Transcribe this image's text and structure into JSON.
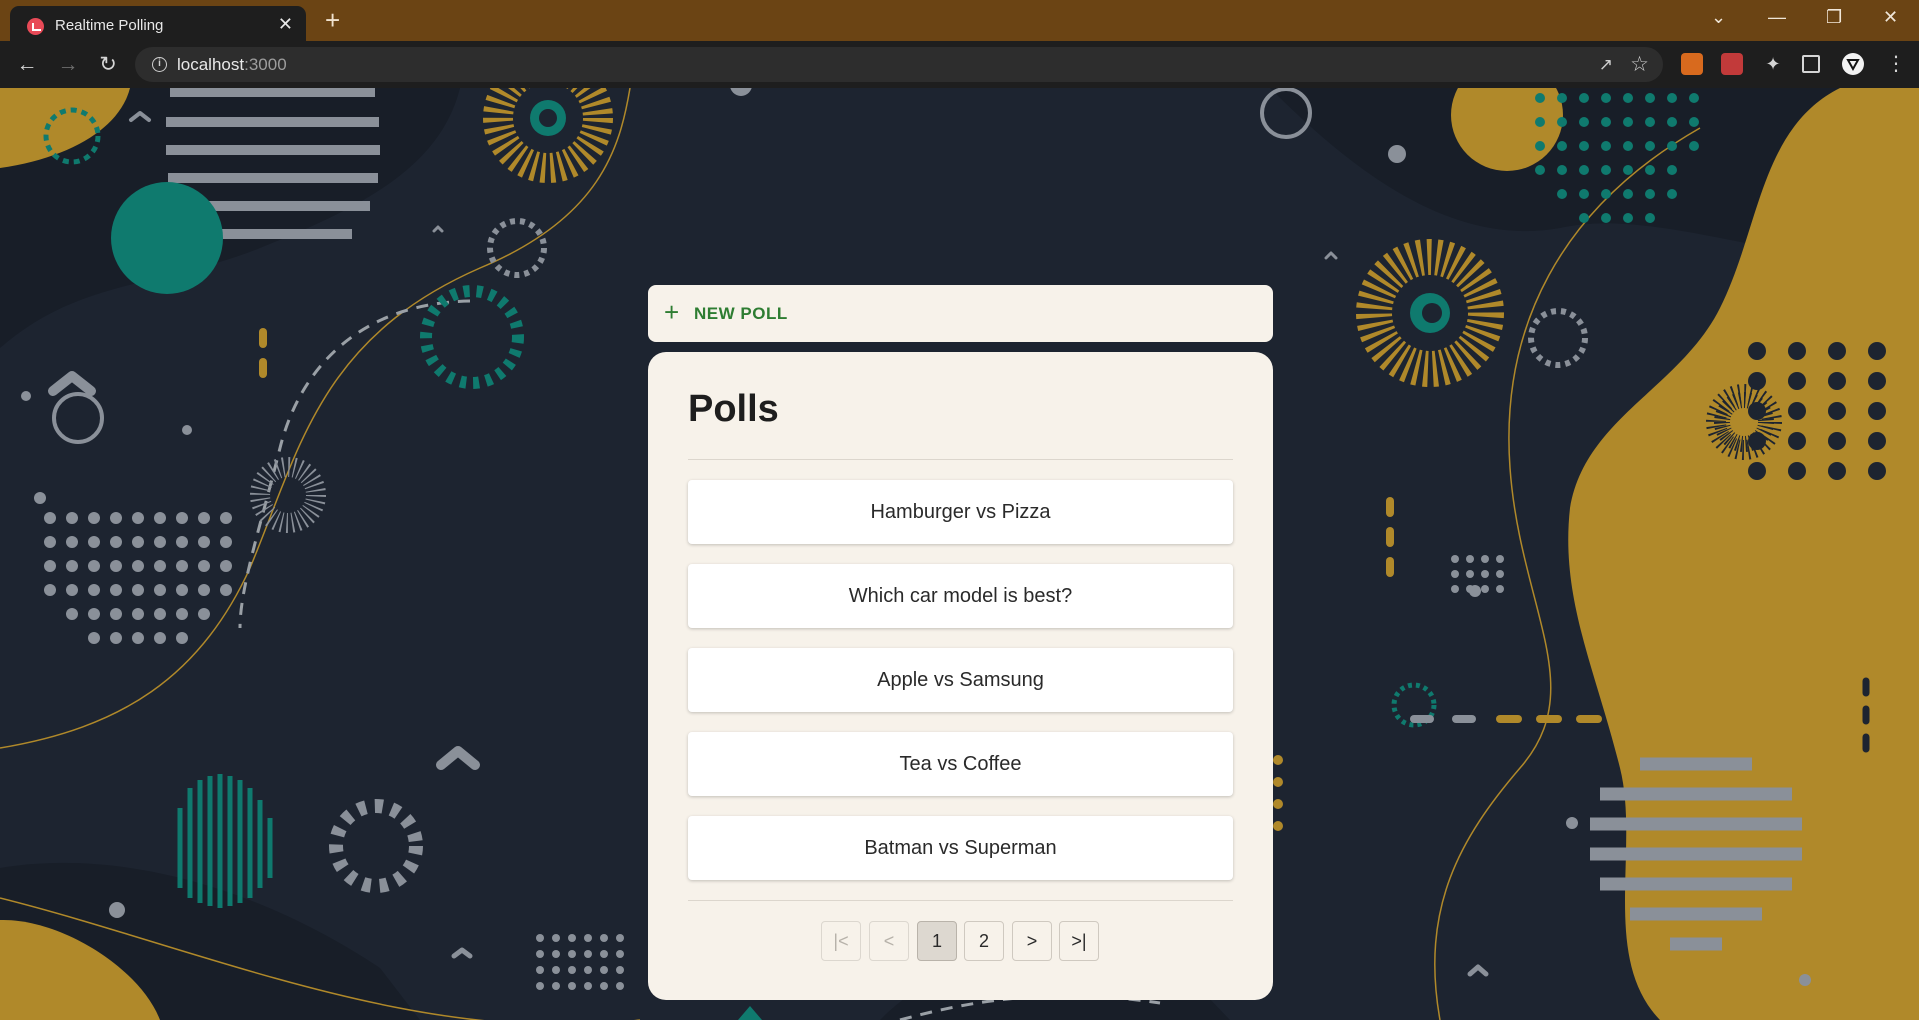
{
  "browser": {
    "tab_title": "Realtime Polling",
    "tab_close_glyph": "✕",
    "new_tab_glyph": "+",
    "url_host": "localhost",
    "url_port": ":3000",
    "icons": {
      "back": "back-arrow-icon",
      "forward": "forward-arrow-icon",
      "reload": "reload-icon",
      "info": "site-info-icon",
      "share": "share-icon",
      "bookmark": "star-icon",
      "extensions": [
        "metamask-extension-icon",
        "extension-icon",
        "puzzle-extensions-icon",
        "side-panel-icon",
        "vercel-extension-icon",
        "menu-kebab-icon"
      ]
    },
    "window_controls": [
      "⌄",
      "—",
      "❐",
      "✕"
    ]
  },
  "app": {
    "new_poll_label": "NEW POLL",
    "new_poll_icon": "plus-icon",
    "heading": "Polls",
    "polls": [
      "Hamburger vs Pizza",
      "Which car model is best?",
      "Apple vs Samsung",
      "Tea vs Coffee",
      "Batman vs Superman"
    ],
    "pagination": {
      "first": "|<",
      "prev": "<",
      "pages": [
        "1",
        "2"
      ],
      "current_page": "1",
      "next": ">",
      "last": ">|"
    }
  },
  "colors": {
    "titlebar": "#6b4414",
    "page_background": "#1d2430",
    "card": "#f7f2ea",
    "accent_green": "#2e7d32",
    "mustard": "#b0892a",
    "teal": "#0f7a6e",
    "gray": "#9aa0a6"
  }
}
